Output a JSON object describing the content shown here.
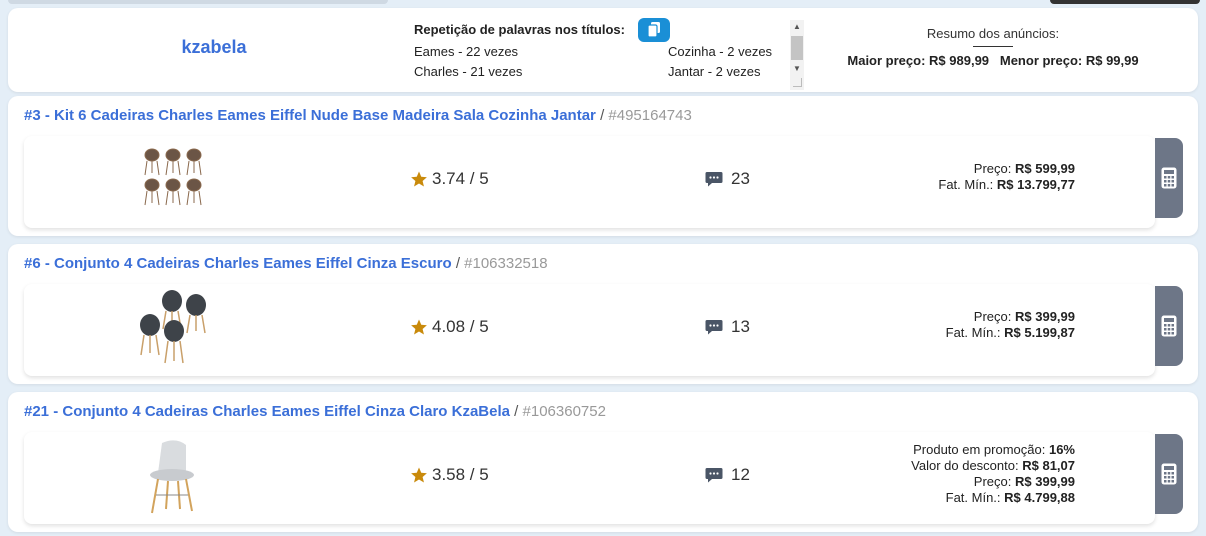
{
  "seller": "kzabela",
  "repetition": {
    "title": "Repetição de palavras nos títulos:",
    "words": [
      "Eames - 22 vezes",
      "Charles - 21 vezes",
      "Cozinha - 2 vezes",
      "Jantar - 2 vezes"
    ]
  },
  "summary": {
    "title": "Resumo dos anúncios:",
    "max_label": "Maior preço:",
    "max_value": "R$ 989,99",
    "min_label": "Menor preço:",
    "min_value": "R$ 99,99"
  },
  "products": [
    {
      "title": "#3 - Kit 6 Cadeiras Charles Eames Eiffel Nude Base Madeira Sala Cozinha Jantar",
      "id": "#495164743",
      "rating": "3.74 / 5",
      "comments": "23",
      "lines": [
        {
          "label": "Preço:",
          "value": "R$ 599,99"
        },
        {
          "label": "Fat. Mín.:",
          "value": "R$ 13.799,77"
        }
      ]
    },
    {
      "title": "#6 - Conjunto 4 Cadeiras Charles Eames Eiffel Cinza Escuro",
      "id": "#106332518",
      "rating": "4.08 / 5",
      "comments": "13",
      "lines": [
        {
          "label": "Preço:",
          "value": "R$ 399,99"
        },
        {
          "label": "Fat. Mín.:",
          "value": "R$ 5.199,87"
        }
      ]
    },
    {
      "title": "#21 - Conjunto 4 Cadeiras Charles Eames Eiffel Cinza Claro KzaBela",
      "id": "#106360752",
      "rating": "3.58 / 5",
      "comments": "12",
      "lines": [
        {
          "label": "Produto em promoção:",
          "value": "16%"
        },
        {
          "label": "Valor do desconto:",
          "value": "R$ 81,07"
        },
        {
          "label": "Preço:",
          "value": "R$ 399,99"
        },
        {
          "label": "Fat. Mín.:",
          "value": "R$ 4.799,88"
        }
      ]
    }
  ],
  "colors": {
    "accent": "#3b6fd8",
    "copy_button": "#1a8fd6",
    "calc_button": "#6d7687",
    "star": "#c98a0b"
  }
}
